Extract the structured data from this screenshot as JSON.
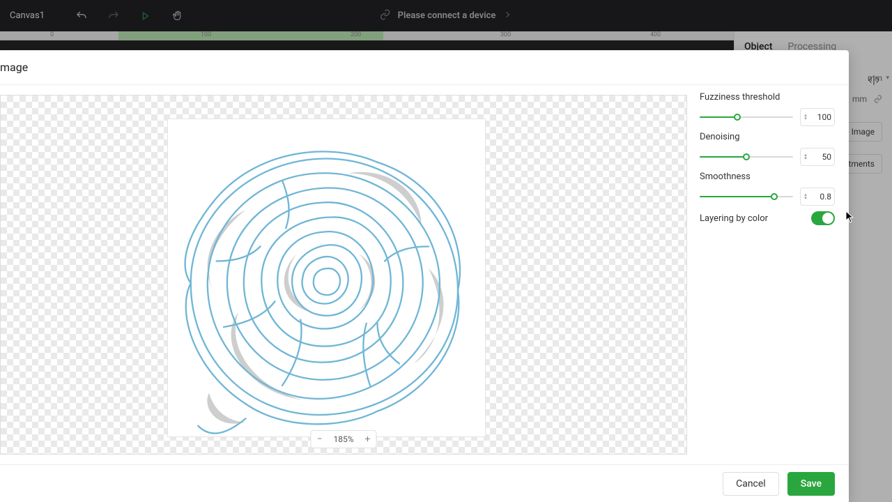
{
  "app": {
    "tab_name": "Canvas1",
    "connect_msg": "Please connect a device"
  },
  "ruler": {
    "marks": [
      "0",
      "100",
      "200",
      "300",
      "400"
    ]
  },
  "side_panel": {
    "tab_object": "Object",
    "tab_processing": "Processing",
    "unit": "mm",
    "btn_trace": "ce Image",
    "btn_adjust": "ustments"
  },
  "modal": {
    "title": "mage",
    "zoom": "185%",
    "controls": {
      "fuzziness": {
        "label": "Fuzziness threshold",
        "value": "100",
        "pct": 40
      },
      "denoising": {
        "label": "Denoising",
        "value": "50",
        "pct": 50
      },
      "smoothness": {
        "label": "Smoothness",
        "value": "0.8",
        "pct": 80
      },
      "layering": {
        "label": "Layering by color",
        "on": true
      }
    },
    "cancel": "Cancel",
    "save": "Save"
  }
}
